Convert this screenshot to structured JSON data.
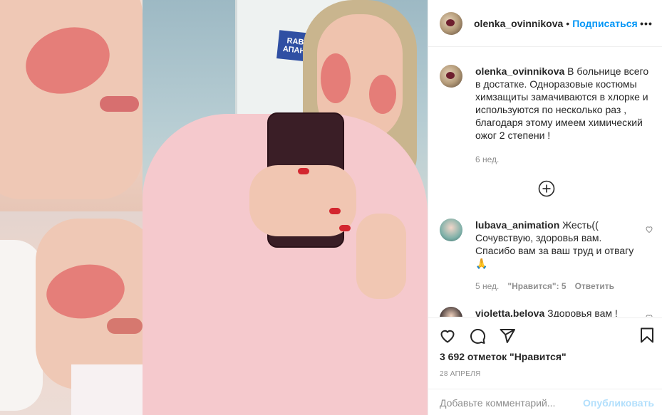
{
  "post": {
    "username": "olenka_ovinnikova",
    "follow_label": "Подписаться",
    "more_label": "•••",
    "photo_sign_text": "RABE\nАПАНО"
  },
  "caption": {
    "username": "olenka_ovinnikova",
    "text": "В больнице всего в достатке. Одноразовые костюмы химзащиты замачиваются в хлорке и используются по несколько раз , благодаря этому имеем химический ожог 2 степени !",
    "time": "6 нед."
  },
  "comments": [
    {
      "username": "lubava_animation",
      "text": "Жесть(( Сочувствую, здоровья вам. Спасибо вам за ваш труд и отвагу🙏",
      "time": "5 нед.",
      "likes": "\"Нравится\": 5",
      "reply": "Ответить"
    },
    {
      "username": "violetta.belova",
      "text": "Здоровья вам !"
    }
  ],
  "actions": {
    "likes_text": "3 692 отметок \"Нравится\"",
    "date": "28 АПРЕЛЯ"
  },
  "add_comment": {
    "placeholder": "Добавьте комментарий...",
    "publish_label": "Опубликовать"
  },
  "colors": {
    "accent": "#0095f6",
    "publish_disabled": "#b2dffc",
    "muted": "#8e8e8e",
    "text": "#262626"
  },
  "icons": [
    "more-icon",
    "load-more-icon",
    "heart-icon",
    "comment-icon",
    "share-icon",
    "bookmark-icon",
    "comment-like-icon"
  ]
}
